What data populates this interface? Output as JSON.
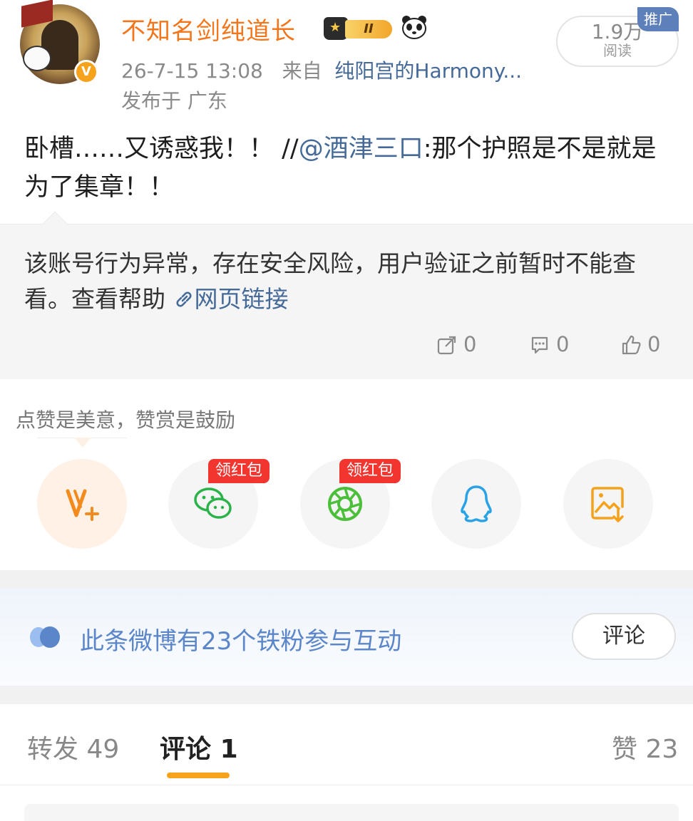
{
  "post": {
    "username": "不知名剑纯道长",
    "vip_level": "II",
    "verified_mark": "V",
    "timestamp": "26-7-15 13:08",
    "source_prefix": "来自",
    "source": "纯阳宫的Harmony...",
    "location": "发布于 广东",
    "read_count": "1.9万",
    "read_label": "阅读",
    "promo_tag": "推广",
    "text_main": "卧槽……又诱惑我！！ //",
    "mention": "@酒津三口",
    "text_after_mention": ":那个护照是不是就是为了集章！！"
  },
  "quoted": {
    "text": "该账号行为异常，存在安全风险，用户验证之前暂时不能查看。查看帮助 ",
    "link_label": "网页链接",
    "reposts": "0",
    "comments": "0",
    "likes": "0"
  },
  "reward": {
    "hint": "点赞是美意，赞赏是鼓励",
    "share_targets": [
      {
        "icon": "v-plus-icon",
        "color": "#f28a1c"
      },
      {
        "icon": "wechat-icon",
        "color": "#2bb34a",
        "tag": "领红包"
      },
      {
        "icon": "moments-icon",
        "color": "#4cbf3a",
        "tag": "领红包"
      },
      {
        "icon": "qq-icon",
        "color": "#2aa3e6"
      },
      {
        "icon": "save-image-icon",
        "color": "#f5a21b"
      }
    ]
  },
  "fans_banner": {
    "text": "此条微博有23个铁粉参与互动",
    "button": "评论"
  },
  "tabs": {
    "repost_label": "转发",
    "repost_count": "49",
    "comment_label": "评论",
    "comment_count": "1",
    "like_label": "赞",
    "like_count": "23"
  },
  "colors": {
    "username": "#f2761c",
    "link": "#456a98",
    "accent": "#f7a21b",
    "red_tag": "#f2362f"
  }
}
